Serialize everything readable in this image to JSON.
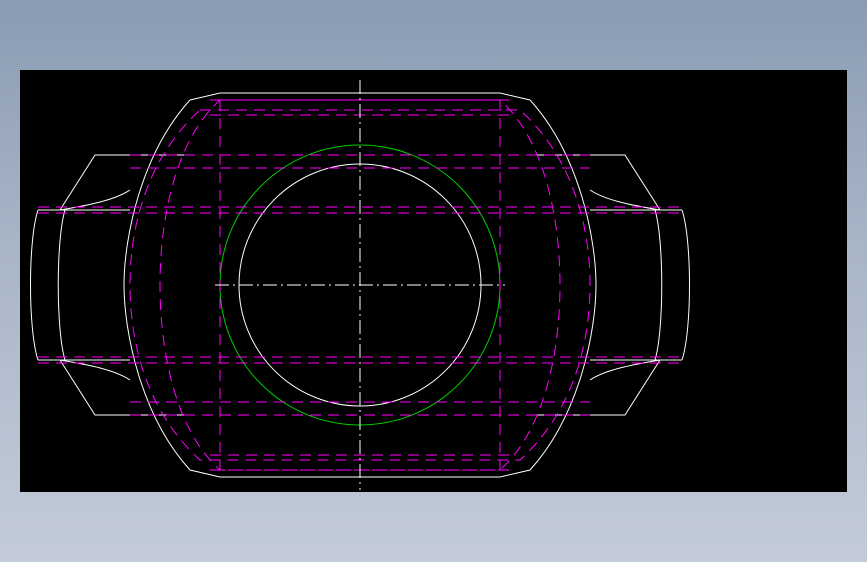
{
  "viewer": {
    "background": "#000000",
    "page_background": "#9aa9bd"
  },
  "drawing": {
    "colors": {
      "outline": "#ffffff",
      "hidden": "#ff00ff",
      "bore_edge": "#00cc00",
      "centerline": "#ffffff"
    }
  }
}
